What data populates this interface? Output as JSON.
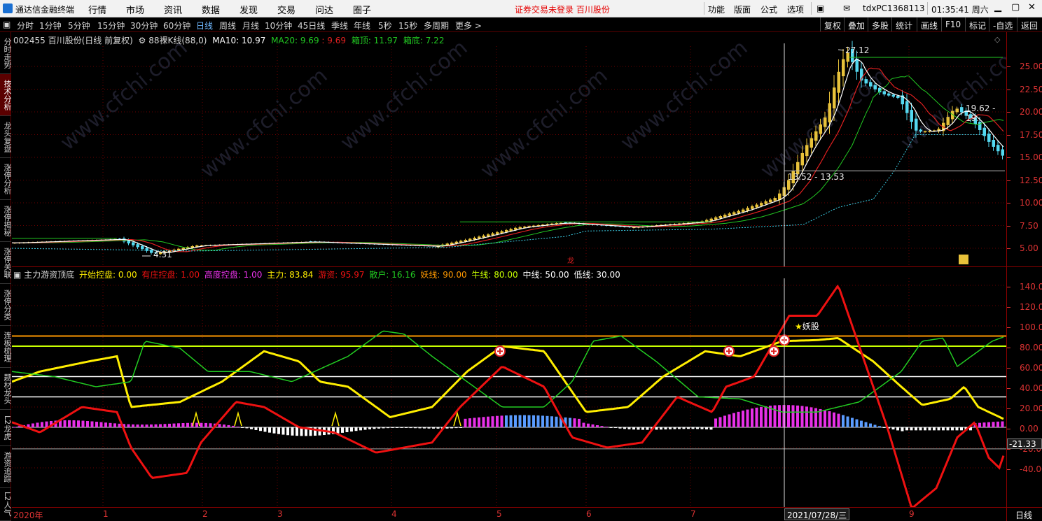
{
  "app": {
    "title": "通达信金融终端",
    "menus": [
      "行情",
      "市场",
      "资讯",
      "数据",
      "发现",
      "交易",
      "问达",
      "圈子"
    ],
    "notice": "证券交易未登录  百川股份",
    "right_menus": [
      "功能",
      "版面",
      "公式",
      "选项"
    ],
    "account": "tdxPC1368113",
    "clock": "01:35:41 周六"
  },
  "toolbar": {
    "periods": [
      "分时",
      "1分钟",
      "5分钟",
      "15分钟",
      "30分钟",
      "60分钟",
      "日线",
      "周线",
      "月线",
      "10分钟",
      "45日线",
      "季线",
      "年线",
      "5秒",
      "15秒",
      "多周期",
      "更多 >"
    ],
    "active_period": "日线",
    "right_buttons": [
      "复权",
      "叠加",
      "多股",
      "统计",
      "画线",
      "F10",
      "标记",
      "-自选",
      "返回"
    ]
  },
  "sidebar": {
    "tabs": [
      "分时走势",
      "技术分析",
      "龙头复盘",
      "涨停分析",
      "涨停揭秘",
      "涨停关联",
      "涨停分类",
      "连板梳理",
      "题材龙头",
      "L2龙虎",
      "游资追踪",
      "L2人气"
    ],
    "active": "技术分析"
  },
  "main_chart": {
    "info": {
      "code_name": "002455 百川股份(日线 前复权)",
      "indicator": "88裸K线(88,0)",
      "ma10": "MA10: 10.97",
      "ma20": "MA20: 9.69",
      "ma20_tail": ": 9.69",
      "box_top": "箱顶: 11.97",
      "box_bottom": "箱底: 7.22"
    },
    "annotations": {
      "high": "27.12",
      "low": "4.31",
      "box_label_1": "13.52 - 13.53",
      "box_label_2": "19.62 - 19."
    },
    "y_ticks": [
      "25.00",
      "22.50",
      "20.00",
      "17.50",
      "15.00",
      "12.50",
      "10.00",
      "7.50",
      "5.00"
    ],
    "colors": {
      "up": "#e8c23a",
      "down": "#54d8f0",
      "ma5": "#ffffff",
      "ma10": "#e02020",
      "ma20": "#22c822",
      "box": "#22c822"
    },
    "watermark": "www.cfchi.com",
    "markers": {
      "buy_marker": "龙"
    }
  },
  "sub_chart": {
    "info": {
      "name": "主力游资顶底",
      "start": "开始控盘: 0.00",
      "heavy": "有庄控盘: 1.00",
      "high": "高度控盘: 1.00",
      "main": "主力: 83.84",
      "hot": "游资: 95.97",
      "retail": "散户: 16.16",
      "demon": "妖线: 90.00",
      "bull": "牛线: 80.00",
      "mid": "中线: 50.00",
      "low": "低线: 30.00"
    },
    "demon_label": "妖股",
    "current_value": "-21.33",
    "y_ticks": [
      "140.00",
      "120.00",
      "100.00",
      "80.00",
      "60.00",
      "40.00",
      "20.00",
      "0.00",
      "-20.00",
      "-40.00"
    ],
    "colors": {
      "main": "#ffee00",
      "hot": "#ee1111",
      "retail": "#22cc22",
      "demon": "#ff9900",
      "bull": "#c8ff00",
      "mid": "#ffffff",
      "low": "#ffffff"
    }
  },
  "date_axis": {
    "labels": [
      "2020年",
      "1",
      "2",
      "3",
      "4",
      "5",
      "6",
      "7",
      "9"
    ],
    "cursor": "2021/07/28/三",
    "period": "日线"
  },
  "chart_data": {
    "type": "line",
    "title": "002455 百川股份(日线 前复权)",
    "ylabel": "",
    "ylim": [
      3.5,
      27.5
    ],
    "x": [
      "2020年",
      "1",
      "2",
      "3",
      "4",
      "5",
      "6",
      "7",
      "2021/07/28",
      "9"
    ],
    "series": [
      {
        "name": "MA10",
        "values": [
          5.6,
          5.9,
          5.3,
          5.6,
          5.3,
          6.5,
          7.3,
          7.6,
          10.97,
          19.6
        ]
      },
      {
        "name": "MA20",
        "values": [
          5.7,
          6.0,
          5.6,
          5.5,
          5.4,
          6.2,
          7.1,
          7.4,
          9.69,
          20.0
        ]
      },
      {
        "name": "箱顶",
        "values": [
          6.1,
          6.1,
          6.1,
          6.1,
          6.1,
          7.9,
          7.9,
          7.9,
          11.97,
          26.0
        ]
      },
      {
        "name": "箱底",
        "values": [
          5.0,
          5.0,
          4.6,
          5.0,
          4.9,
          6.5,
          6.6,
          7.1,
          7.22,
          17.5
        ]
      }
    ]
  }
}
